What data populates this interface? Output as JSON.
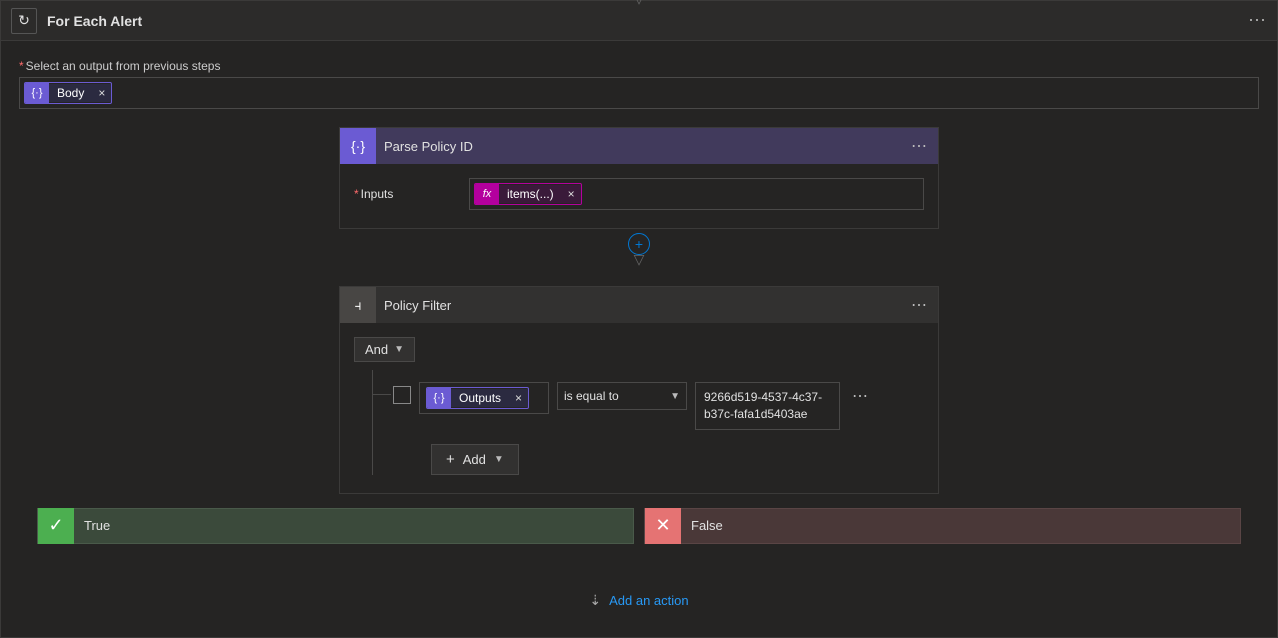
{
  "forEach": {
    "title": "For Each Alert",
    "selectLabel": "Select an output from previous steps",
    "bodyToken": "Body"
  },
  "parsePolicy": {
    "title": "Parse Policy ID",
    "inputsLabel": "Inputs",
    "fxToken": "items(...)"
  },
  "policyFilter": {
    "title": "Policy Filter",
    "andLabel": "And",
    "outputsToken": "Outputs",
    "operator": "is equal to",
    "value1": "9266d519-4537-4c37-",
    "value2": "b37c-fafa1d5403ae",
    "addLabel": "Add"
  },
  "branches": {
    "trueLabel": "True",
    "falseLabel": "False"
  },
  "addAction": "Add an action"
}
